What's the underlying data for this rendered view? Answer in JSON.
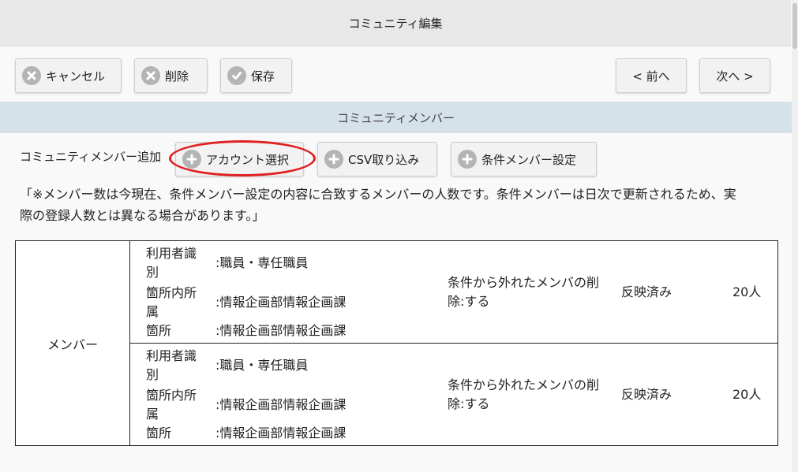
{
  "header": {
    "title": "コミュニティ編集"
  },
  "toolbar": {
    "cancel_label": "キャンセル",
    "delete_label": "削除",
    "save_label": "保存",
    "prev_label": "< 前へ",
    "next_label": "次へ >"
  },
  "section": {
    "title": "コミュニティメンバー"
  },
  "add_member": {
    "label": "コミュニティメンバー追加",
    "account_select_label": "アカウント選択",
    "csv_import_label": "CSV取り込み",
    "condition_member_label": "条件メンバー設定"
  },
  "note": {
    "line1": "「※メンバー数は今現在、条件メンバー設定の内容に合致するメンバーの人数です。条件メンバーは日次で更新されるため、実",
    "line2": "際の登録人数とは異なる場合があります。」"
  },
  "members_table": {
    "label": "メンバー",
    "rows": [
      {
        "user_type_key": "利用者識別",
        "user_type_key_l1": "利用者識",
        "user_type_key_l2": "別",
        "user_type_value": ":職員・専任職員",
        "dept_in_key_l1": "箇所内所",
        "dept_in_key_l2": "属",
        "dept_in_value": ":情報企画部情報企画課",
        "dept_key": "箇所",
        "dept_value": ":情報企画部情報企画課",
        "remove_l1": "条件から外れたメンバの削",
        "remove_l2": "除:する",
        "status": "反映済み",
        "count": "20人"
      },
      {
        "user_type_key": "利用者識別",
        "user_type_key_l1": "利用者識",
        "user_type_key_l2": "別",
        "user_type_value": ":職員・専任職員",
        "dept_in_key_l1": "箇所内所",
        "dept_in_key_l2": "属",
        "dept_in_value": ":情報企画部情報企画課",
        "dept_key": "箇所",
        "dept_value": ":情報企画部情報企画課",
        "remove_l1": "条件から外れたメンバの削",
        "remove_l2": "除:する",
        "status": "反映済み",
        "count": "20人"
      }
    ]
  },
  "colors": {
    "highlight": "#e02020",
    "section_bg": "#d6e2ea",
    "header_bg": "#e8e8e8"
  }
}
